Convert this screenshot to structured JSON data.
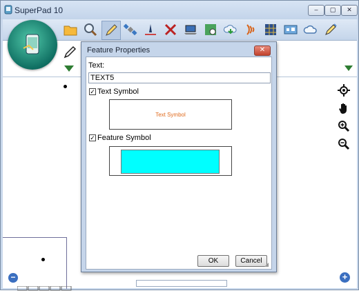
{
  "window": {
    "title": "SuperPad 10",
    "minimize_glyph": "–",
    "maximize_glyph": "▢",
    "close_glyph": "✕"
  },
  "toolbar": {
    "tools": [
      {
        "name": "folder-icon"
      },
      {
        "name": "zoom-icon"
      },
      {
        "name": "edit-pencil-icon"
      },
      {
        "name": "satellite-icon"
      },
      {
        "name": "survey-icon"
      },
      {
        "name": "tools-icon"
      },
      {
        "name": "laptop-icon"
      },
      {
        "name": "map-view-icon"
      },
      {
        "name": "cloud-download-icon"
      },
      {
        "name": "signal-icon"
      },
      {
        "name": "grid-icon"
      },
      {
        "name": "world-map-icon"
      },
      {
        "name": "cloud-icon"
      },
      {
        "name": "pencil-tool-icon"
      }
    ]
  },
  "dialog": {
    "title": "Feature Properties",
    "close_glyph": "✕",
    "text_label": "Text:",
    "text_value": "TEXT5",
    "text_symbol_label": "Text Symbol",
    "text_symbol_checked": true,
    "text_symbol_preview": "Text Symbol",
    "feature_symbol_label": "Feature Symbol",
    "feature_symbol_checked": true,
    "feature_symbol_color": "#00ffff",
    "ok_label": "OK",
    "cancel_label": "Cancel"
  },
  "map_controls": {
    "zoom_out_glyph": "−",
    "zoom_in_glyph": "+"
  },
  "colors": {
    "accent": "#c5d5ea",
    "text_symbol": "#e06a1c",
    "arrow_green": "#2e7d32"
  }
}
